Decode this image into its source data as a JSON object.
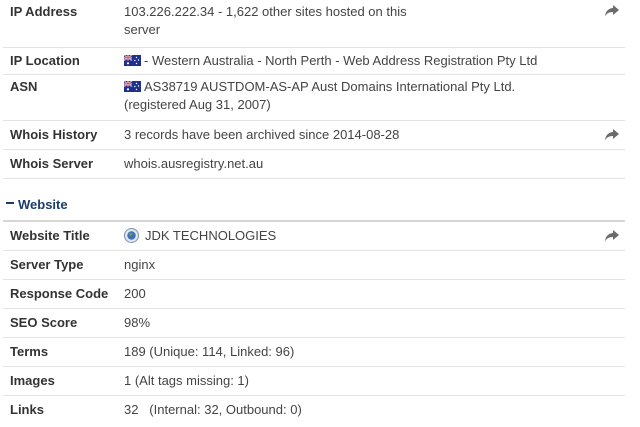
{
  "whois": {
    "ip_address": {
      "label": "IP Address",
      "value_line1": "103.226.222.34 - 1,622 other sites hosted on this",
      "value_line2": "server"
    },
    "ip_location": {
      "label": "IP Location",
      "value": "- Western Australia - North Perth - Web Address Registration Pty Ltd"
    },
    "asn": {
      "label": "ASN",
      "value_line1": "AS38719 AUSTDOM-AS-AP Aust Domains International Pty Ltd.",
      "value_line2": "(registered Aug 31, 2007)"
    },
    "whois_history": {
      "label": "Whois History",
      "value": "3 records have been archived since 2014-08-28"
    },
    "whois_server": {
      "label": "Whois Server",
      "value": "whois.ausregistry.net.au"
    }
  },
  "website_section": {
    "title": "Website",
    "toggle_icon": "minus-icon"
  },
  "website": {
    "website_title": {
      "label": "Website Title",
      "value": "JDK TECHNOLOGIES"
    },
    "server_type": {
      "label": "Server Type",
      "value": "nginx"
    },
    "response_code": {
      "label": "Response Code",
      "value": "200"
    },
    "seo_score": {
      "label": "SEO Score",
      "value": "98%"
    },
    "terms": {
      "label": "Terms",
      "value": "189 (Unique: 114, Linked: 96)"
    },
    "images": {
      "label": "Images",
      "value": "1 (Alt tags missing: 1)"
    },
    "links": {
      "label": "Links",
      "value": "32   (Internal: 32, Outbound: 0)"
    }
  },
  "colors": {
    "section_title": "#1a3d6e",
    "share_icon": "#6b6b6b",
    "divider": "#e3e3e3"
  },
  "icons": {
    "share": "share-arrow-icon",
    "flag": "australia-flag-icon",
    "favicon": "globe-icon"
  }
}
